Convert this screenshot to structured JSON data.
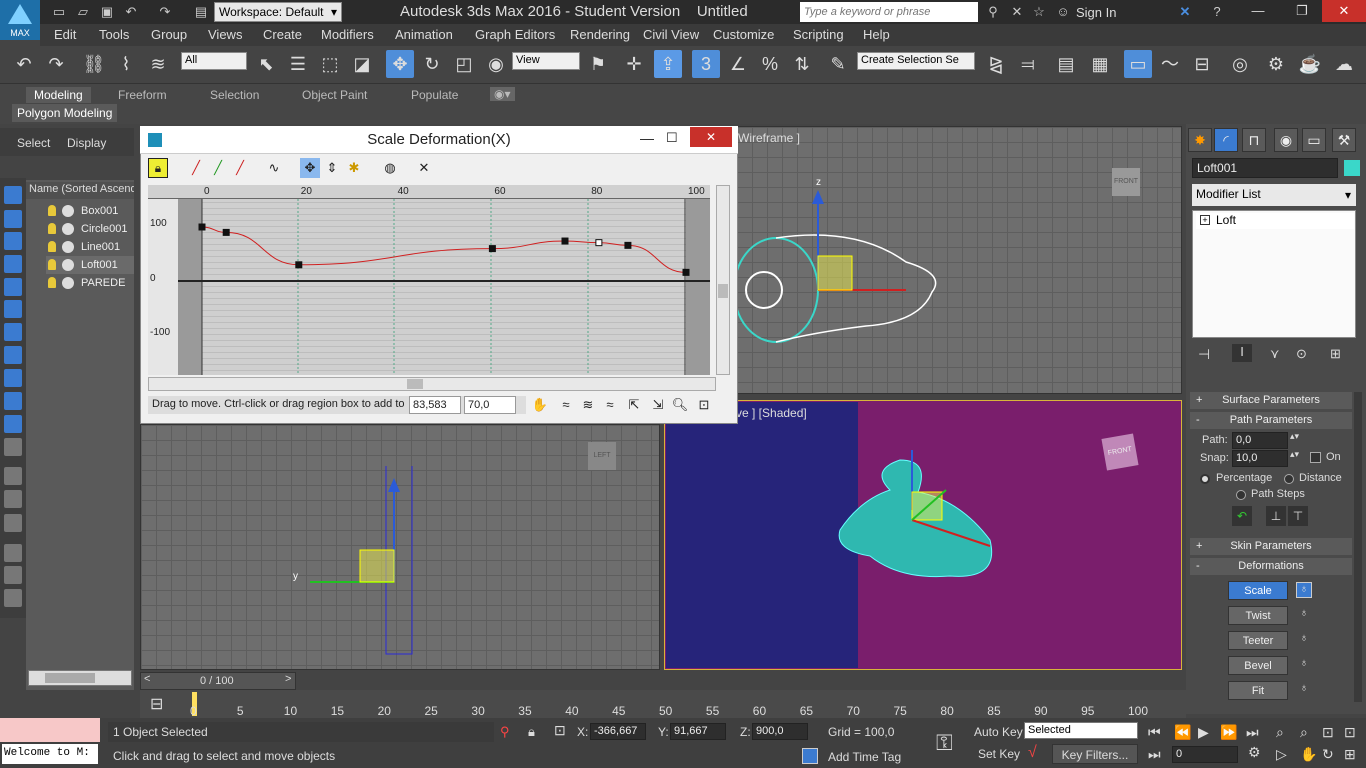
{
  "app": {
    "title": "Autodesk 3ds Max 2016 - Student Version    Untitled",
    "workspace": "Workspace: Default",
    "search_placeholder": "Type a keyword or phrase",
    "sign_in": "Sign In",
    "logo_text": "MAX"
  },
  "menu": [
    "Edit",
    "Tools",
    "Group",
    "Views",
    "Create",
    "Modifiers",
    "Animation",
    "Graph Editors",
    "Rendering",
    "Civil View",
    "Customize",
    "Scripting",
    "Help"
  ],
  "toolbar": {
    "filter": "All",
    "ref_coord": "View",
    "selection_set": "Create Selection Se"
  },
  "ribbon": {
    "tabs": [
      "Modeling",
      "Freeform",
      "Selection",
      "Object Paint",
      "Populate"
    ],
    "panel": "Polygon Modeling"
  },
  "explorer": {
    "select": "Select",
    "display": "Display",
    "header": "Name (Sorted Ascend",
    "items": [
      {
        "name": "Box001",
        "selected": false
      },
      {
        "name": "Circle001",
        "selected": false
      },
      {
        "name": "Line001",
        "selected": false
      },
      {
        "name": "Loft001",
        "selected": true
      },
      {
        "name": "PAREDE",
        "selected": false
      }
    ]
  },
  "dialog": {
    "title": "Scale Deformation(X)",
    "ruler": [
      "0",
      "20",
      "40",
      "60",
      "80",
      "100"
    ],
    "yticks": [
      "100",
      "0",
      "-100"
    ],
    "status": "Drag to move. Ctrl-click or drag region box to add to",
    "coord_x": "83,583",
    "coord_y": "70,0",
    "curve": [
      [
        0,
        100
      ],
      [
        5,
        90
      ],
      [
        20,
        30
      ],
      [
        60,
        60
      ],
      [
        75,
        74
      ],
      [
        82,
        71
      ],
      [
        88,
        66
      ],
      [
        100,
        16
      ]
    ]
  },
  "viewports": {
    "top_right_label": "Wireframe ]",
    "bottom_right_label": "ve ] [Shaded]",
    "top_cube": "FRONT",
    "left_cube": "LEFT",
    "persp_cube": "FRONT"
  },
  "command": {
    "object_name": "Loft001",
    "color": "#3ad7c9",
    "modifier_list": "Modifier List",
    "stack": [
      "Loft"
    ],
    "rollouts": {
      "surface": "Surface Parameters",
      "path": "Path Parameters",
      "skin": "Skin Parameters",
      "deform": "Deformations"
    },
    "path_label": "Path:",
    "path_value": "0,0",
    "snap_label": "Snap:",
    "snap_value": "10,0",
    "on": "On",
    "percentage": "Percentage",
    "distance": "Distance",
    "path_steps": "Path Steps",
    "deformations": [
      "Scale",
      "Twist",
      "Teeter",
      "Bevel",
      "Fit"
    ]
  },
  "timeline": {
    "frame": "0 / 100",
    "ticks": [
      "0",
      "5",
      "10",
      "15",
      "20",
      "25",
      "30",
      "35",
      "40",
      "45",
      "50",
      "55",
      "60",
      "65",
      "70",
      "75",
      "80",
      "85",
      "90",
      "95",
      "100"
    ]
  },
  "status": {
    "objects": "1 Object Selected",
    "prompt": "Click and drag to select and move objects",
    "x_label": "X:",
    "x": "-366,667",
    "y_label": "Y:",
    "y": "91,667",
    "z_label": "Z:",
    "z": "900,0",
    "grid": "Grid = 100,0",
    "add_time_tag": "Add Time Tag",
    "auto_key": "Auto Key",
    "selected": "Selected",
    "set_key": "Set Key",
    "key_filters": "Key Filters...",
    "frame_field": "0",
    "welcome": "Welcome to M:"
  }
}
